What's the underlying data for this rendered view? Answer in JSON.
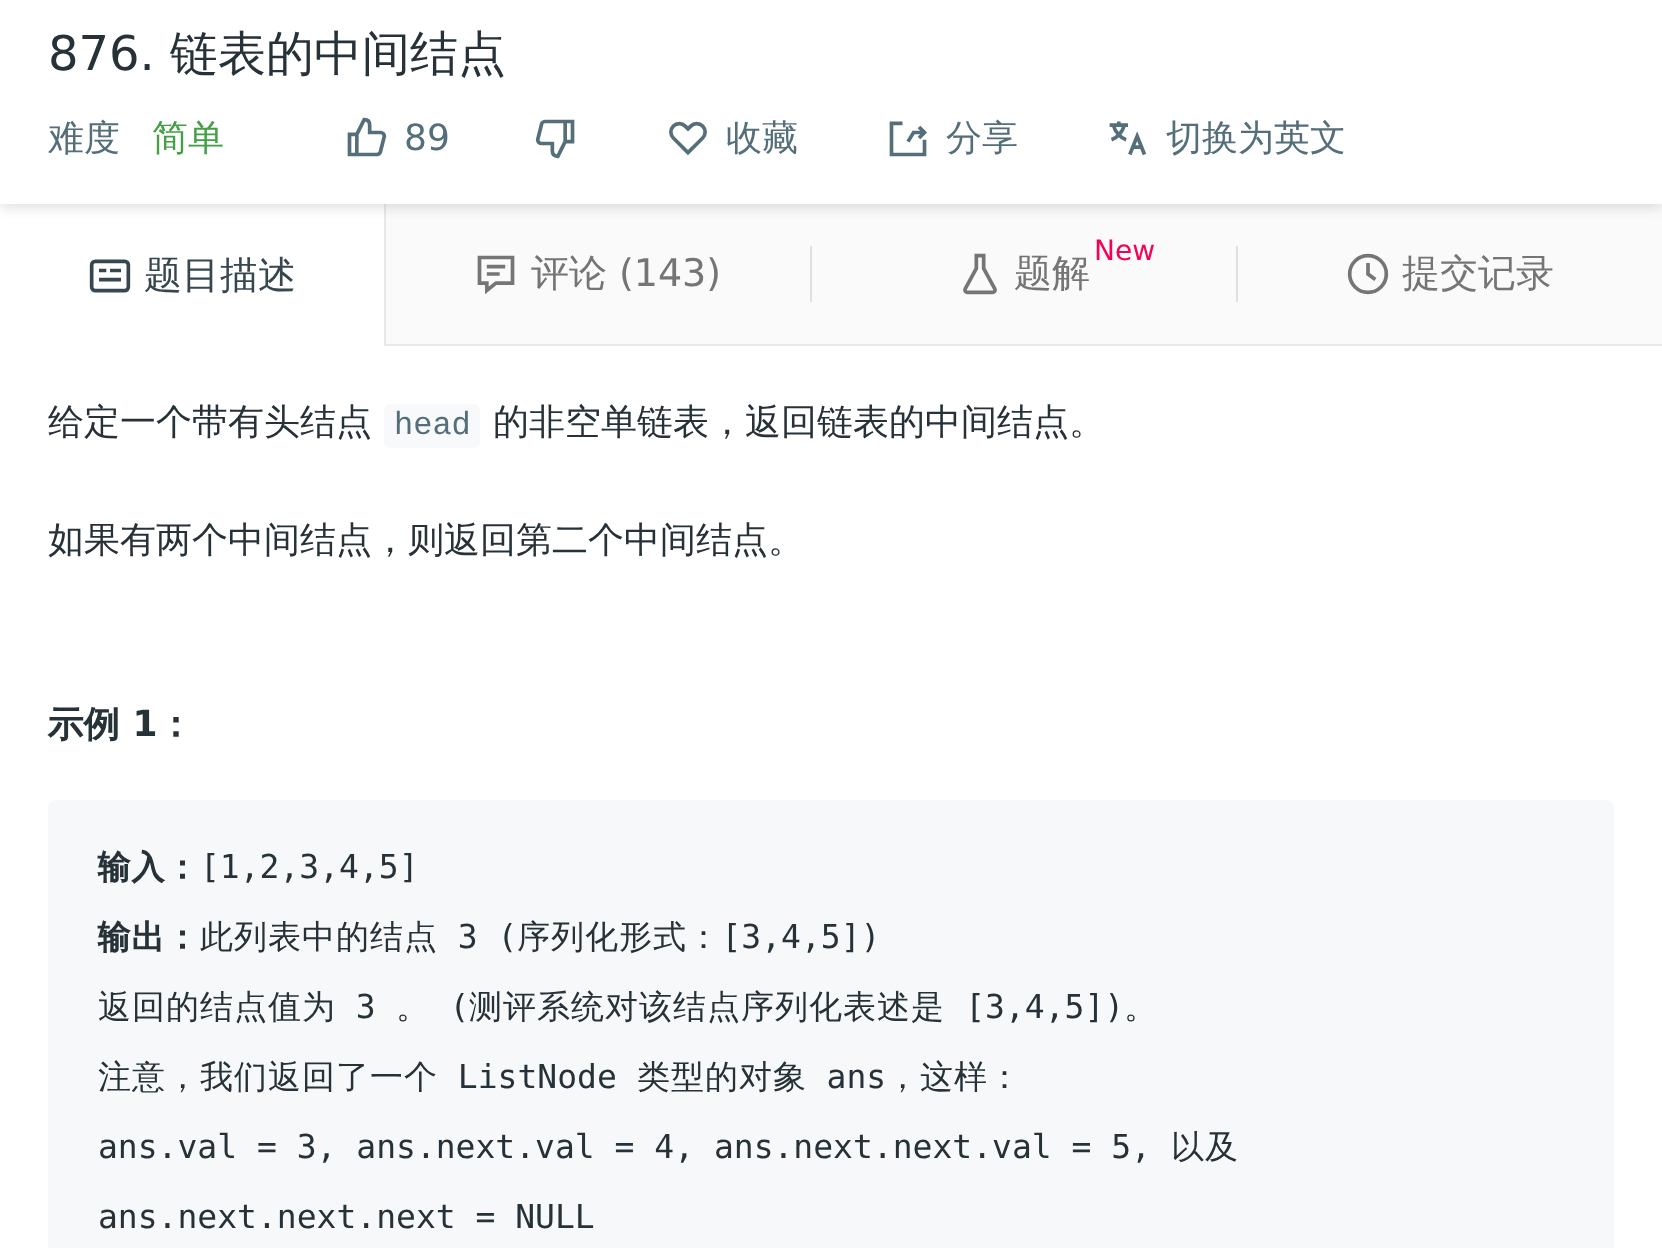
{
  "problem": {
    "title": "876. 链表的中间结点",
    "difficulty_label": "难度",
    "difficulty": "简单",
    "likes": "89",
    "favorite": "收藏",
    "share": "分享",
    "translate": "切换为英文"
  },
  "tabs": [
    {
      "label": "题目描述",
      "kind": "description",
      "selected": true
    },
    {
      "label": "评论 (143)",
      "kind": "comment",
      "selected": false
    },
    {
      "label": "题解",
      "kind": "flask",
      "badge": "New",
      "selected": false
    },
    {
      "label": "提交记录",
      "kind": "clock",
      "selected": false
    }
  ],
  "description": {
    "paragraphs": [
      [
        {
          "kind": "text",
          "text": "给定一个带有头结点"
        },
        {
          "kind": "code",
          "text": "head"
        },
        {
          "kind": "text",
          "text": "的非空单链表，返回链表的中间结点。"
        }
      ],
      [
        {
          "kind": "text",
          "text": "如果有两个中间结点，则返回第二个中间结点。"
        }
      ]
    ],
    "example_heading": "示例 1：",
    "example_lines": [
      "**输入：**[1,2,3,4,5]",
      "**输出：**此列表中的结点 3 (序列化形式：[3,4,5])",
      "返回的结点值为 3 。 (测评系统对该结点序列化表述是 [3,4,5])。",
      "注意，我们返回了一个 ListNode 类型的对象 ans，这样：",
      "ans.val = 3, ans.next.val = 4, ans.next.next.val = 5, 以及",
      "ans.next.next.next = NULL"
    ]
  }
}
